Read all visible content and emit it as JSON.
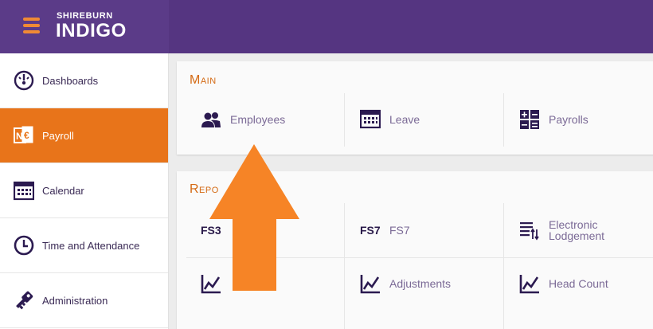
{
  "brand": {
    "top": "SHIREBURN",
    "main": "INDIGO"
  },
  "sidebar": {
    "items": [
      {
        "label": "Dashboards",
        "icon": "dashboard-gauge-icon"
      },
      {
        "label": "Payroll",
        "icon": "payroll-euro-icon",
        "active": true
      },
      {
        "label": "Calendar",
        "icon": "calendar-icon"
      },
      {
        "label": "Time and Attendance",
        "icon": "clock-icon"
      },
      {
        "label": "Administration",
        "icon": "key-icon"
      }
    ]
  },
  "main": {
    "title": "Main",
    "tiles": [
      {
        "label": "Employees",
        "icon": "employees-icon"
      },
      {
        "label": "Leave",
        "icon": "calendar-icon"
      },
      {
        "label": "Payrolls",
        "icon": "calculator-icon"
      }
    ]
  },
  "reports": {
    "title": "Repo",
    "tiles": [
      {
        "code": "FS3",
        "label": ""
      },
      {
        "code": "FS7",
        "label": "FS7"
      },
      {
        "label": "Electronic Lodgement",
        "line1": "Electronic",
        "line2": "Lodgement",
        "icon": "sort-list-icon"
      },
      {
        "label": "",
        "icon": "line-chart-icon"
      },
      {
        "label": "Adjustments",
        "icon": "line-chart-icon"
      },
      {
        "label": "Head Count",
        "icon": "line-chart-icon"
      }
    ]
  },
  "colors": {
    "topbar": "#553581",
    "accent": "#e8741a",
    "arrow": "#f68426",
    "icon": "#2b1a50"
  }
}
